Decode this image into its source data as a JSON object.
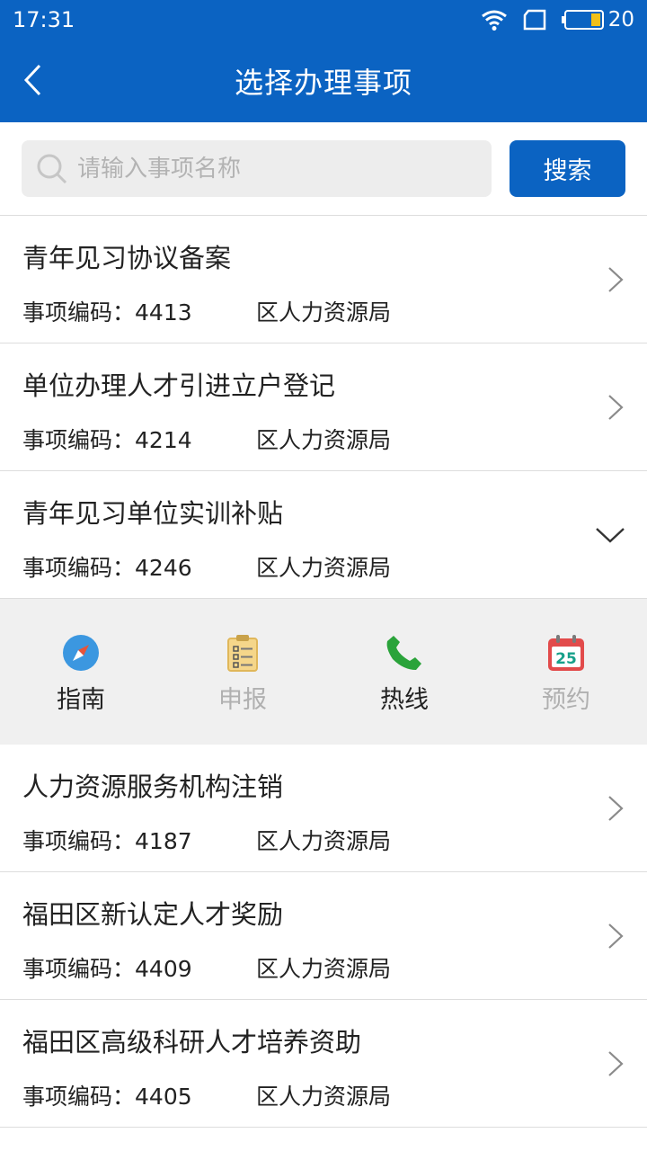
{
  "status": {
    "time": "17:31",
    "battery": "20"
  },
  "header": {
    "title": "选择办理事项"
  },
  "search": {
    "placeholder": "请输入事项名称",
    "value": "",
    "button": "搜索"
  },
  "code_label": "事项编码：",
  "items_top": [
    {
      "title": "青年见习协议备案",
      "code": "4413",
      "dept": "区人力资源局"
    },
    {
      "title": "单位办理人才引进立户登记",
      "code": "4214",
      "dept": "区人力资源局"
    },
    {
      "title": "青年见习单位实训补贴",
      "code": "4246",
      "dept": "区人力资源局"
    }
  ],
  "actions": [
    {
      "label": "指南",
      "icon": "compass-icon",
      "enabled": true
    },
    {
      "label": "申报",
      "icon": "clipboard-icon",
      "enabled": false
    },
    {
      "label": "热线",
      "icon": "phone-icon",
      "enabled": true
    },
    {
      "label": "预约",
      "icon": "calendar-icon",
      "enabled": false,
      "icon_text": "25"
    }
  ],
  "items_bottom": [
    {
      "title": "人力资源服务机构注销",
      "code": "4187",
      "dept": "区人力资源局"
    },
    {
      "title": "福田区新认定人才奖励",
      "code": "4409",
      "dept": "区人力资源局"
    },
    {
      "title": "福田区高级科研人才培养资助",
      "code": "4405",
      "dept": "区人力资源局"
    }
  ],
  "colors": {
    "primary": "#0b63c2",
    "actionbar_bg": "#f0f0f0",
    "disabled_text": "#b0b0b0",
    "phone_green": "#2aa33a",
    "calendar_red": "#e24b4b"
  }
}
